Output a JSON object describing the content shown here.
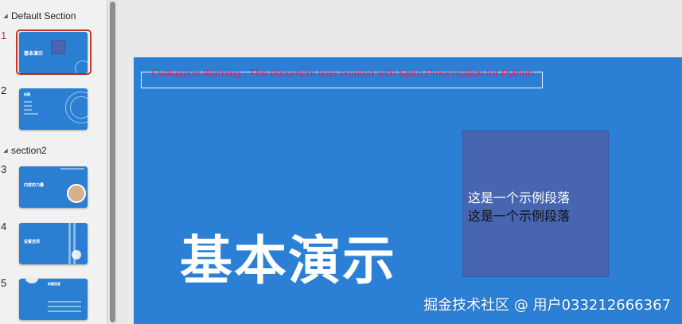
{
  "sections": [
    {
      "label": "Default Section"
    },
    {
      "label": "section2"
    }
  ],
  "slides": [
    {
      "num": "1",
      "title": "基本演示"
    },
    {
      "num": "2",
      "title": "标题"
    },
    {
      "num": "3",
      "title": "内容的力量"
    },
    {
      "num": "4",
      "title": "设置选项"
    },
    {
      "num": "5",
      "title": "标题信息"
    }
  ],
  "main_slide": {
    "warning": "Evaluation Warning : The document was created with Spire.Presentation for Python",
    "paragraph_1": "这是一个示例段落",
    "paragraph_2": "这是一个示例段落",
    "title": "基本演示"
  },
  "watermark": "掘金技术社区 @ 用户033212666367",
  "colors": {
    "slide_bg": "#2b80d6",
    "content_box": "#4765b1",
    "warning_text": "#d6246b",
    "selection": "#c0392b"
  }
}
